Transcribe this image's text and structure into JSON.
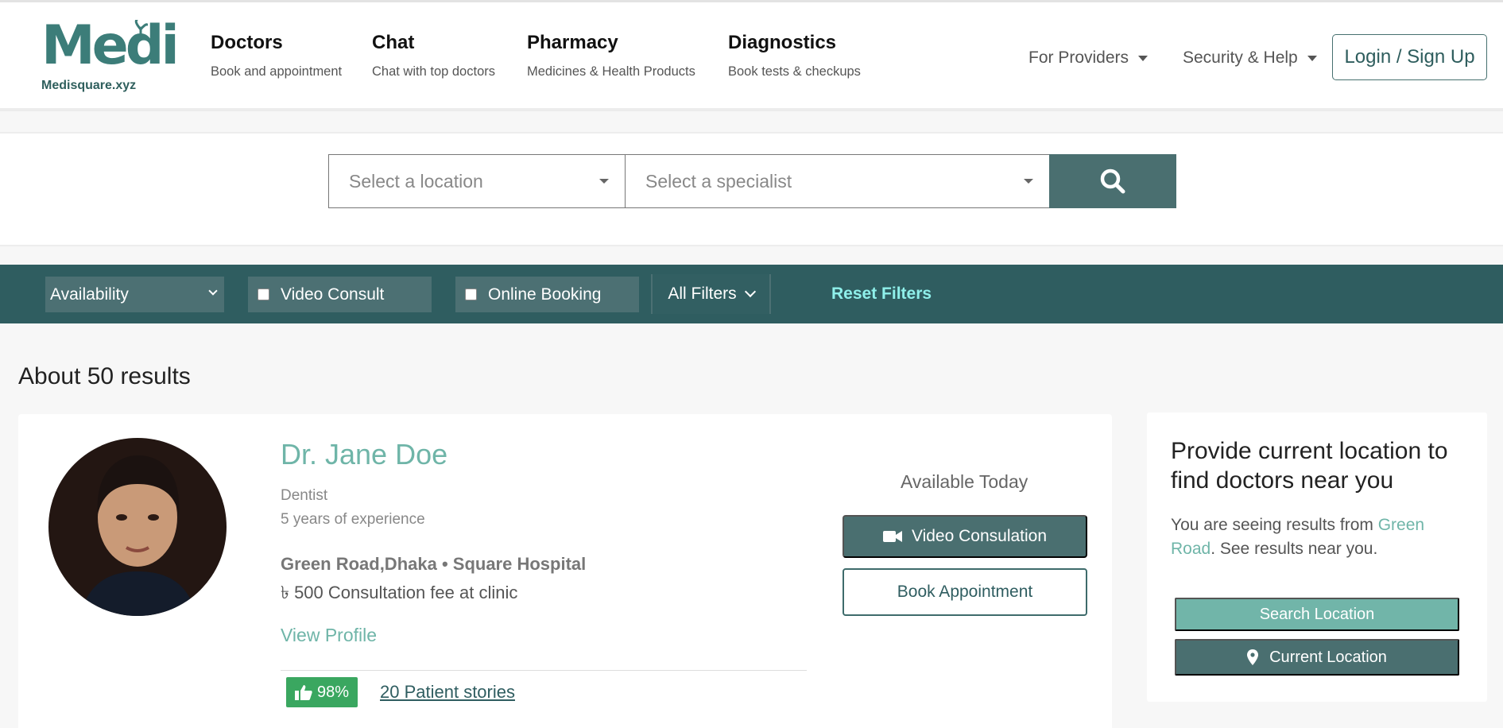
{
  "header": {
    "logo_text": "Medi",
    "logo_subtext": "Medisquare.xyz",
    "nav": [
      {
        "title": "Doctors",
        "subtitle": "Book and appointment"
      },
      {
        "title": "Chat",
        "subtitle": "Chat with top doctors"
      },
      {
        "title": "Pharmacy",
        "subtitle": "Medicines & Health Products"
      },
      {
        "title": "Diagnostics",
        "subtitle": "Book tests & checkups"
      }
    ],
    "providers_label": "For Providers",
    "security_label": "Security & Help",
    "login_label": "Login / Sign Up"
  },
  "search": {
    "location_placeholder": "Select a location",
    "specialist_placeholder": "Select a specialist",
    "button_icon": "search-icon"
  },
  "filters": {
    "availability": "Availability",
    "video_consult": "Video Consult",
    "online_booking": "Online Booking",
    "all_filters": "All Filters",
    "reset": "Reset Filters"
  },
  "results_text": "About 50 results",
  "doctor": {
    "name": "Dr. Jane Doe",
    "specialty": "Dentist",
    "experience": "5 years of experience",
    "location": "Green Road,Dhaka • Square Hospital",
    "fee": "৳ 500 Consultation fee at clinic",
    "view_profile": "View Profile",
    "rating": "98%",
    "stories": "20 Patient stories",
    "availability": "Available Today",
    "video_button": "Video Consulation",
    "book_button": "Book Appointment"
  },
  "side_panel": {
    "title": "Provide current location to find doctors near you",
    "text_before": "You are seeing results from ",
    "text_location": "Green Road",
    "text_after": ". See results near you.",
    "search_location": "Search Location",
    "current_location": "Current Location"
  },
  "colors": {
    "primary": "#2f5d60",
    "button": "#4a6f70",
    "accent": "#6fb5a8",
    "rating": "#3aa760",
    "reset": "#8ff0ea"
  }
}
